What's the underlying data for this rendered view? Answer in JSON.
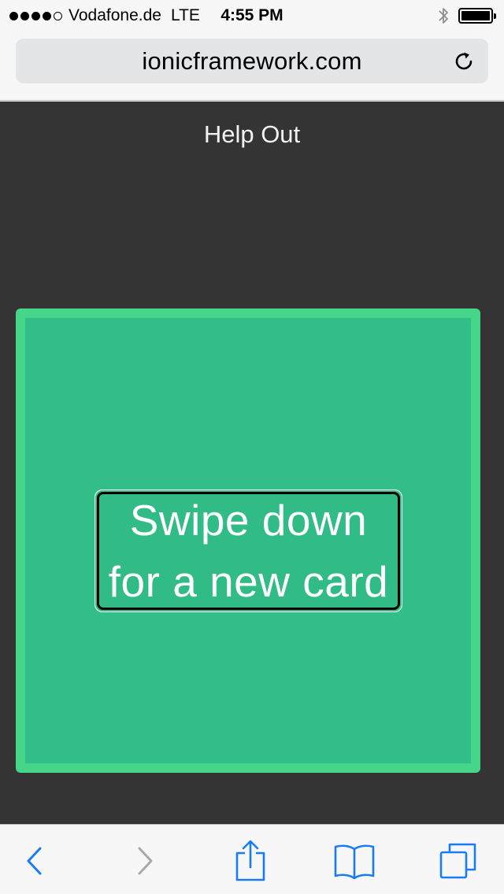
{
  "status_bar": {
    "carrier": "Vodafone.de",
    "network": "LTE",
    "time": "4:55 PM",
    "signal_bars_filled": 4,
    "signal_bars_total": 5,
    "battery_level": 1.0,
    "icons": [
      "bluetooth-icon",
      "battery-icon"
    ]
  },
  "browser": {
    "url": "ionicframework.com",
    "reload_icon": "reload-icon"
  },
  "page": {
    "title": "Help Out",
    "card": {
      "line1": "Swipe down",
      "line2": "for a new card"
    },
    "colors": {
      "background": "#343434",
      "card_fill": "#32bd89",
      "card_border": "#45d689"
    }
  },
  "toolbar": {
    "buttons": [
      "back-icon",
      "forward-icon",
      "share-icon",
      "bookmarks-icon",
      "tabs-icon"
    ],
    "accent": "#1a7cf4",
    "disabled": "#a9a9a9"
  }
}
